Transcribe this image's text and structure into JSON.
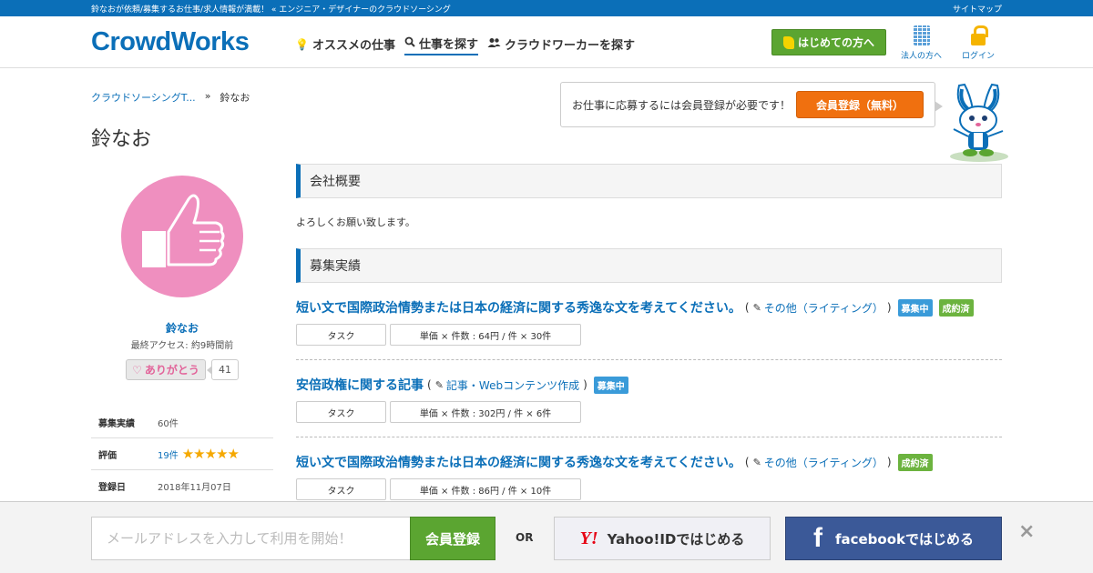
{
  "topbar": {
    "tagline": "鈴なおが依頼/募集するお仕事/求人情報が満載！ « エンジニア・デザイナーのクラウドソーシング",
    "sitemap": "サイトマップ"
  },
  "header": {
    "logo": "CrowdWorks",
    "nav": [
      {
        "label": "オススメの仕事",
        "icon": "lightbulb-icon"
      },
      {
        "label": "仕事を探す",
        "icon": "search-icon"
      },
      {
        "label": "クラウドワーカーを探す",
        "icon": "users-icon"
      }
    ],
    "beginner_button": "はじめての方へ",
    "corporate_link": "法人の方へ",
    "login_link": "ログイン"
  },
  "breadcrumb": {
    "root": "クラウドソーシングT...",
    "separator": "»",
    "current": "鈴なお"
  },
  "page_title": "鈴なお",
  "registration": {
    "message": "お仕事に応募するには会員登録が必要です！",
    "button": "会員登録（無料）"
  },
  "profile": {
    "name": "鈴なお",
    "last_access": "最終アクセス: 約9時間前",
    "thanks_label": "ありがとう",
    "thanks_count": "41",
    "stats": [
      {
        "label": "募集実績",
        "value": "60件"
      },
      {
        "label": "評価",
        "value": "19件",
        "stars": "★★★★★"
      },
      {
        "label": "登録日",
        "value": "2018年11月07日"
      }
    ]
  },
  "sections": {
    "company_overview": "会社概要",
    "company_description": "よろしくお願い致します。",
    "recruitment_history": "募集実績"
  },
  "jobs": [
    {
      "title": "短い文で国際政治情勢または日本の経済に関する秀逸な文を考えてください。",
      "open_paren": "(",
      "category": "その他（ライティング）",
      "close_paren": ")",
      "badges": [
        {
          "label": "募集中",
          "kind": "recruiting"
        },
        {
          "label": "成約済",
          "kind": "done"
        }
      ],
      "type": "タスク",
      "price": "単価 × 件数 : 64円 / 件 × 30件"
    },
    {
      "title": "安倍政権に関する記事",
      "open_paren": "(",
      "category": "記事・Webコンテンツ作成",
      "close_paren": ")",
      "badges": [
        {
          "label": "募集中",
          "kind": "recruiting"
        }
      ],
      "type": "タスク",
      "price": "単価 × 件数 : 302円 / 件 × 6件"
    },
    {
      "title": "短い文で国際政治情勢または日本の経済に関する秀逸な文を考えてください。",
      "open_paren": "(",
      "category": "その他（ライティング）",
      "close_paren": ")",
      "badges": [
        {
          "label": "成約済",
          "kind": "done"
        }
      ],
      "type": "タスク",
      "price": "単価 × 件数 : 86円 / 件 × 10件"
    }
  ],
  "bottom_bar": {
    "email_placeholder": "メールアドレスを入力して利用を開始！",
    "signup_button": "会員登録",
    "or": "OR",
    "yahoo_logo": "Y!",
    "yahoo_button": "Yahoo!IDではじめる",
    "facebook_logo": "f",
    "facebook_button": "facebookではじめる",
    "close": "×"
  },
  "colors": {
    "brand_blue": "#0b6fb8",
    "green": "#5ba531",
    "orange": "#f0700f",
    "facebook": "#3b5998",
    "avatar_pink": "#ef8fbf"
  }
}
